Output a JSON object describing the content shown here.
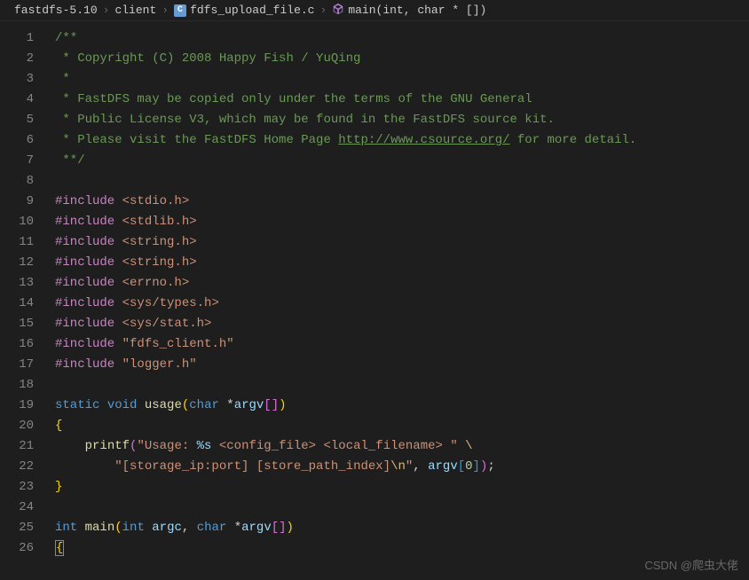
{
  "breadcrumb": {
    "items": [
      {
        "label": "fastdfs-5.10"
      },
      {
        "label": "client"
      },
      {
        "label": "fdfs_upload_file.c",
        "icon": "c"
      },
      {
        "label": "main(int, char * [])",
        "icon": "symbol"
      }
    ],
    "sep": "›"
  },
  "lines": [
    {
      "n": "1",
      "tokens": [
        {
          "c": "comment",
          "t": "/**"
        }
      ]
    },
    {
      "n": "2",
      "tokens": [
        {
          "c": "comment",
          "t": " * Copyright (C) 2008 Happy Fish / YuQing"
        }
      ]
    },
    {
      "n": "3",
      "tokens": [
        {
          "c": "comment",
          "t": " *"
        }
      ]
    },
    {
      "n": "4",
      "tokens": [
        {
          "c": "comment",
          "t": " * FastDFS may be copied only under the terms of the GNU General"
        }
      ]
    },
    {
      "n": "5",
      "tokens": [
        {
          "c": "comment",
          "t": " * Public License V3, which may be found in the FastDFS source kit."
        }
      ]
    },
    {
      "n": "6",
      "tokens": [
        {
          "c": "comment",
          "t": " * Please visit the FastDFS Home Page "
        },
        {
          "c": "comment url",
          "t": "http://www.csource.org/"
        },
        {
          "c": "comment",
          "t": " for more detail."
        }
      ]
    },
    {
      "n": "7",
      "tokens": [
        {
          "c": "comment",
          "t": " **/"
        }
      ]
    },
    {
      "n": "8",
      "tokens": []
    },
    {
      "n": "9",
      "tokens": [
        {
          "c": "keyword2",
          "t": "#include "
        },
        {
          "c": "string",
          "t": "<stdio.h>"
        }
      ]
    },
    {
      "n": "10",
      "tokens": [
        {
          "c": "keyword2",
          "t": "#include "
        },
        {
          "c": "string",
          "t": "<stdlib.h>"
        }
      ]
    },
    {
      "n": "11",
      "tokens": [
        {
          "c": "keyword2",
          "t": "#include "
        },
        {
          "c": "string",
          "t": "<string.h>"
        }
      ]
    },
    {
      "n": "12",
      "tokens": [
        {
          "c": "keyword2",
          "t": "#include "
        },
        {
          "c": "string",
          "t": "<string.h>"
        }
      ]
    },
    {
      "n": "13",
      "tokens": [
        {
          "c": "keyword2",
          "t": "#include "
        },
        {
          "c": "string",
          "t": "<errno.h>"
        }
      ]
    },
    {
      "n": "14",
      "tokens": [
        {
          "c": "keyword2",
          "t": "#include "
        },
        {
          "c": "string",
          "t": "<sys/types.h>"
        }
      ]
    },
    {
      "n": "15",
      "tokens": [
        {
          "c": "keyword2",
          "t": "#include "
        },
        {
          "c": "string",
          "t": "<sys/stat.h>"
        }
      ]
    },
    {
      "n": "16",
      "tokens": [
        {
          "c": "keyword2",
          "t": "#include "
        },
        {
          "c": "string",
          "t": "\"fdfs_client.h\""
        }
      ]
    },
    {
      "n": "17",
      "tokens": [
        {
          "c": "keyword2",
          "t": "#include "
        },
        {
          "c": "string",
          "t": "\"logger.h\""
        }
      ]
    },
    {
      "n": "18",
      "tokens": []
    },
    {
      "n": "19",
      "tokens": [
        {
          "c": "keyword",
          "t": "static"
        },
        {
          "c": "punc",
          "t": " "
        },
        {
          "c": "keyword",
          "t": "void"
        },
        {
          "c": "punc",
          "t": " "
        },
        {
          "c": "func",
          "t": "usage"
        },
        {
          "c": "brace",
          "t": "("
        },
        {
          "c": "keyword",
          "t": "char"
        },
        {
          "c": "punc",
          "t": " *"
        },
        {
          "c": "var",
          "t": "argv"
        },
        {
          "c": "brace-pink",
          "t": "[]"
        },
        {
          "c": "brace",
          "t": ")"
        }
      ]
    },
    {
      "n": "20",
      "tokens": [
        {
          "c": "brace",
          "t": "{"
        }
      ]
    },
    {
      "n": "21",
      "tokens": [
        {
          "c": "punc",
          "t": "    "
        },
        {
          "c": "func",
          "t": "printf"
        },
        {
          "c": "brace-pink",
          "t": "("
        },
        {
          "c": "string",
          "t": "\"Usage: "
        },
        {
          "c": "var",
          "t": "%s"
        },
        {
          "c": "string",
          "t": " <config_file> <local_filename> \""
        },
        {
          "c": "punc",
          "t": " "
        },
        {
          "c": "escape",
          "t": "\\"
        }
      ]
    },
    {
      "n": "22",
      "tokens": [
        {
          "c": "punc",
          "t": "        "
        },
        {
          "c": "string",
          "t": "\"[storage_ip:port] [store_path_index]"
        },
        {
          "c": "escape",
          "t": "\\n"
        },
        {
          "c": "string",
          "t": "\""
        },
        {
          "c": "punc",
          "t": ", "
        },
        {
          "c": "var",
          "t": "argv"
        },
        {
          "c": "brace-blue",
          "t": "["
        },
        {
          "c": "num",
          "t": "0"
        },
        {
          "c": "brace-blue",
          "t": "]"
        },
        {
          "c": "brace-pink",
          "t": ")"
        },
        {
          "c": "punc",
          "t": ";"
        }
      ]
    },
    {
      "n": "23",
      "tokens": [
        {
          "c": "brace",
          "t": "}"
        }
      ]
    },
    {
      "n": "24",
      "tokens": []
    },
    {
      "n": "25",
      "tokens": [
        {
          "c": "keyword",
          "t": "int"
        },
        {
          "c": "punc",
          "t": " "
        },
        {
          "c": "func",
          "t": "main"
        },
        {
          "c": "brace",
          "t": "("
        },
        {
          "c": "keyword",
          "t": "int"
        },
        {
          "c": "punc",
          "t": " "
        },
        {
          "c": "var",
          "t": "argc"
        },
        {
          "c": "punc",
          "t": ", "
        },
        {
          "c": "keyword",
          "t": "char"
        },
        {
          "c": "punc",
          "t": " *"
        },
        {
          "c": "var",
          "t": "argv"
        },
        {
          "c": "brace-pink",
          "t": "[]"
        },
        {
          "c": "brace",
          "t": ")"
        }
      ]
    },
    {
      "n": "26",
      "tokens": [
        {
          "c": "brace cursor-box",
          "t": "{"
        }
      ]
    }
  ],
  "watermark": "CSDN @爬虫大佬"
}
